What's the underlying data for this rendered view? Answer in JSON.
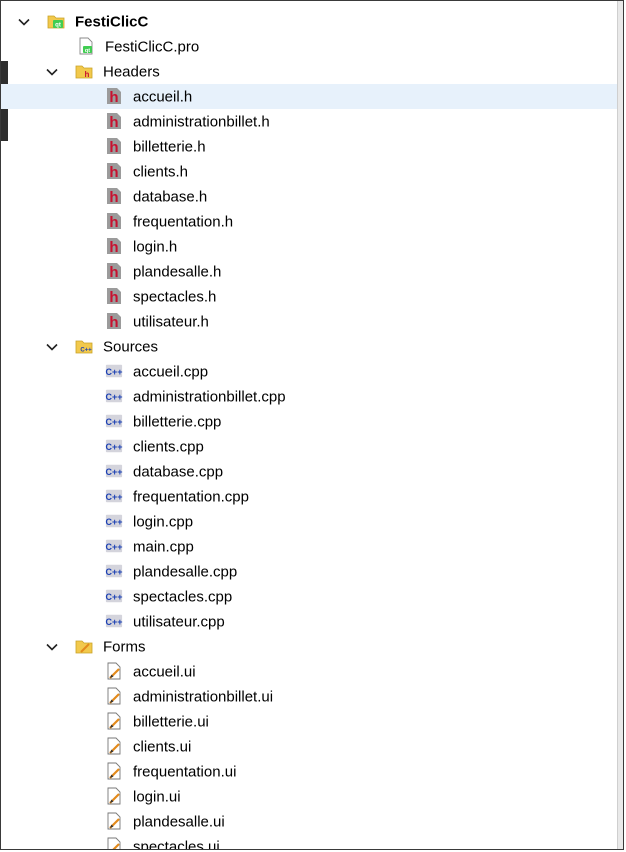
{
  "tree": {
    "root": {
      "label": "FestiClicC",
      "expanded": true
    },
    "project_file": {
      "label": "FestiClicC.pro"
    },
    "headers": {
      "label": "Headers",
      "files": [
        "accueil.h",
        "administrationbillet.h",
        "billetterie.h",
        "clients.h",
        "database.h",
        "frequentation.h",
        "login.h",
        "plandesalle.h",
        "spectacles.h",
        "utilisateur.h"
      ],
      "selected_index": 0
    },
    "sources": {
      "label": "Sources",
      "files": [
        "accueil.cpp",
        "administrationbillet.cpp",
        "billetterie.cpp",
        "clients.cpp",
        "database.cpp",
        "frequentation.cpp",
        "login.cpp",
        "main.cpp",
        "plandesalle.cpp",
        "spectacles.cpp",
        "utilisateur.cpp"
      ]
    },
    "forms": {
      "label": "Forms",
      "files": [
        "accueil.ui",
        "administrationbillet.ui",
        "billetterie.ui",
        "clients.ui",
        "frequentation.ui",
        "login.ui",
        "plandesalle.ui",
        "spectacles.ui"
      ]
    }
  },
  "icons": {
    "project": "qt-project-icon",
    "pro_file": "qt-pro-file-icon",
    "headers_folder": "header-folder-icon",
    "header_file": "header-file-icon",
    "sources_folder": "source-folder-icon",
    "source_file": "cpp-file-icon",
    "forms_folder": "forms-folder-icon",
    "form_file": "ui-form-file-icon",
    "expanded": "chevron-down-icon"
  },
  "colors": {
    "selection": "#e7f1fb",
    "header_red": "#c8102e",
    "cpp_blue": "#1a3fb3",
    "folder_yellow": "#f2c94c",
    "qt_green": "#41cd52",
    "form_orange": "#e38a1b"
  }
}
